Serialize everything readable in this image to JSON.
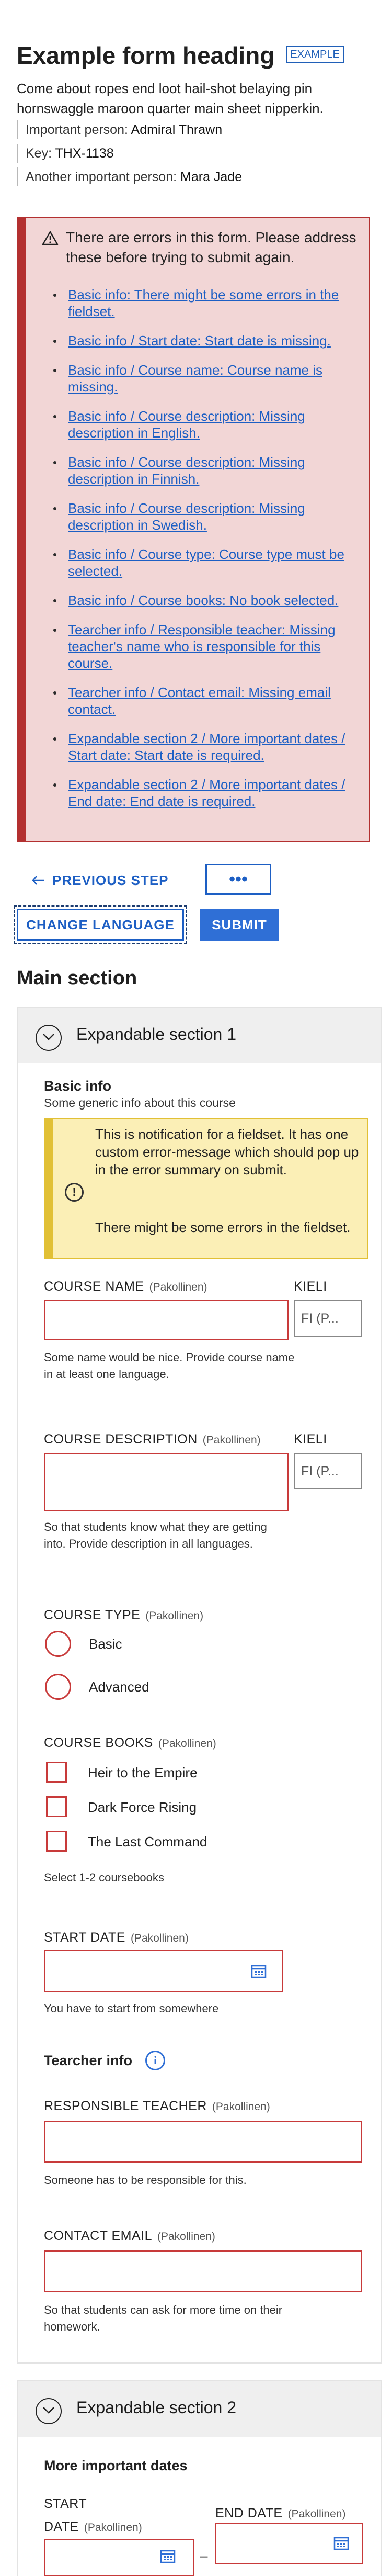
{
  "header": {
    "title": "Example form heading",
    "badge": "EXAMPLE",
    "intro": "Come about ropes end loot hail-shot belaying pin hornswaggle maroon quarter main sheet nipperkin.",
    "meta": [
      {
        "label": "Important person:",
        "value": "Admiral Thrawn"
      },
      {
        "label": "Key:",
        "value": "THX-1138"
      },
      {
        "label": "Another important person:",
        "value": "Mara Jade"
      }
    ]
  },
  "error_summary": {
    "heading": "There are errors in this form. Please address these before trying to submit again.",
    "errors": [
      "Basic info: There might be some errors in the fieldset.",
      "Basic info / Start date: Start date is missing.",
      "Basic info / Course name: Course name is missing.",
      "Basic info / Course description: Missing description in English.",
      "Basic info / Course description: Missing description in Finnish.",
      "Basic info / Course description: Missing description in Swedish.",
      "Basic info / Course type: Course type must be selected.",
      "Basic info / Course books: No book selected.",
      "Tearcher info / Responsible teacher: Missing teacher's name who is responsible for this course.",
      "Tearcher info / Contact email: Missing email contact.",
      "Expandable section 2 / More important dates / Start date: Start date is required.",
      "Expandable section 2 / More important dates / End date: End date is required."
    ]
  },
  "actions": {
    "previous": "PREVIOUS STEP",
    "more": "•••",
    "change_language": "CHANGE LANGUAGE",
    "submit": "SUBMIT"
  },
  "main_section": {
    "title": "Main section",
    "required_suffix": "(Pakollinen)",
    "section1": {
      "title": "Expandable section 1",
      "basic_info": {
        "title": "Basic info",
        "subtitle": "Some generic info about this course",
        "notice_1": "This is notification for a fieldset. It has one custom error-message which should pop up in the error summary on submit.",
        "notice_2": "There might be some errors in the fieldset."
      },
      "course_name": {
        "label": "COURSE NAME",
        "language_label": "KIELI",
        "language_value": "FI (P...",
        "hint": "Some name would be nice. Provide course name in at least one language."
      },
      "course_description": {
        "label": "COURSE DESCRIPTION",
        "language_label": "KIELI",
        "language_value": "FI (P...",
        "hint": "So that students know what they are getting into. Provide description in all languages."
      },
      "course_type": {
        "label": "COURSE TYPE",
        "options": [
          "Basic",
          "Advanced"
        ]
      },
      "course_books": {
        "label": "COURSE BOOKS",
        "options": [
          "Heir to the Empire",
          "Dark Force Rising",
          "The Last Command"
        ],
        "hint": "Select 1-2 coursebooks"
      },
      "start_date": {
        "label": "START DATE",
        "hint": "You have to start from somewhere"
      },
      "teacher_info": {
        "title": "Tearcher info",
        "responsible_label": "RESPONSIBLE TEACHER",
        "responsible_hint": "Someone has to be responsible for this.",
        "email_label": "CONTACT EMAIL",
        "email_hint": "So that students can ask for more time on their homework."
      }
    },
    "section2": {
      "title": "Expandable section 2",
      "dates_title": "More important dates",
      "start_label_1": "START",
      "start_label_2": "DATE",
      "end_label": "END DATE",
      "separator": "–"
    }
  },
  "colors": {
    "accent": "#2f6fd6",
    "error": "#b33030",
    "error_bg": "#f2d6d6",
    "notice_bg": "#fbefb6"
  }
}
